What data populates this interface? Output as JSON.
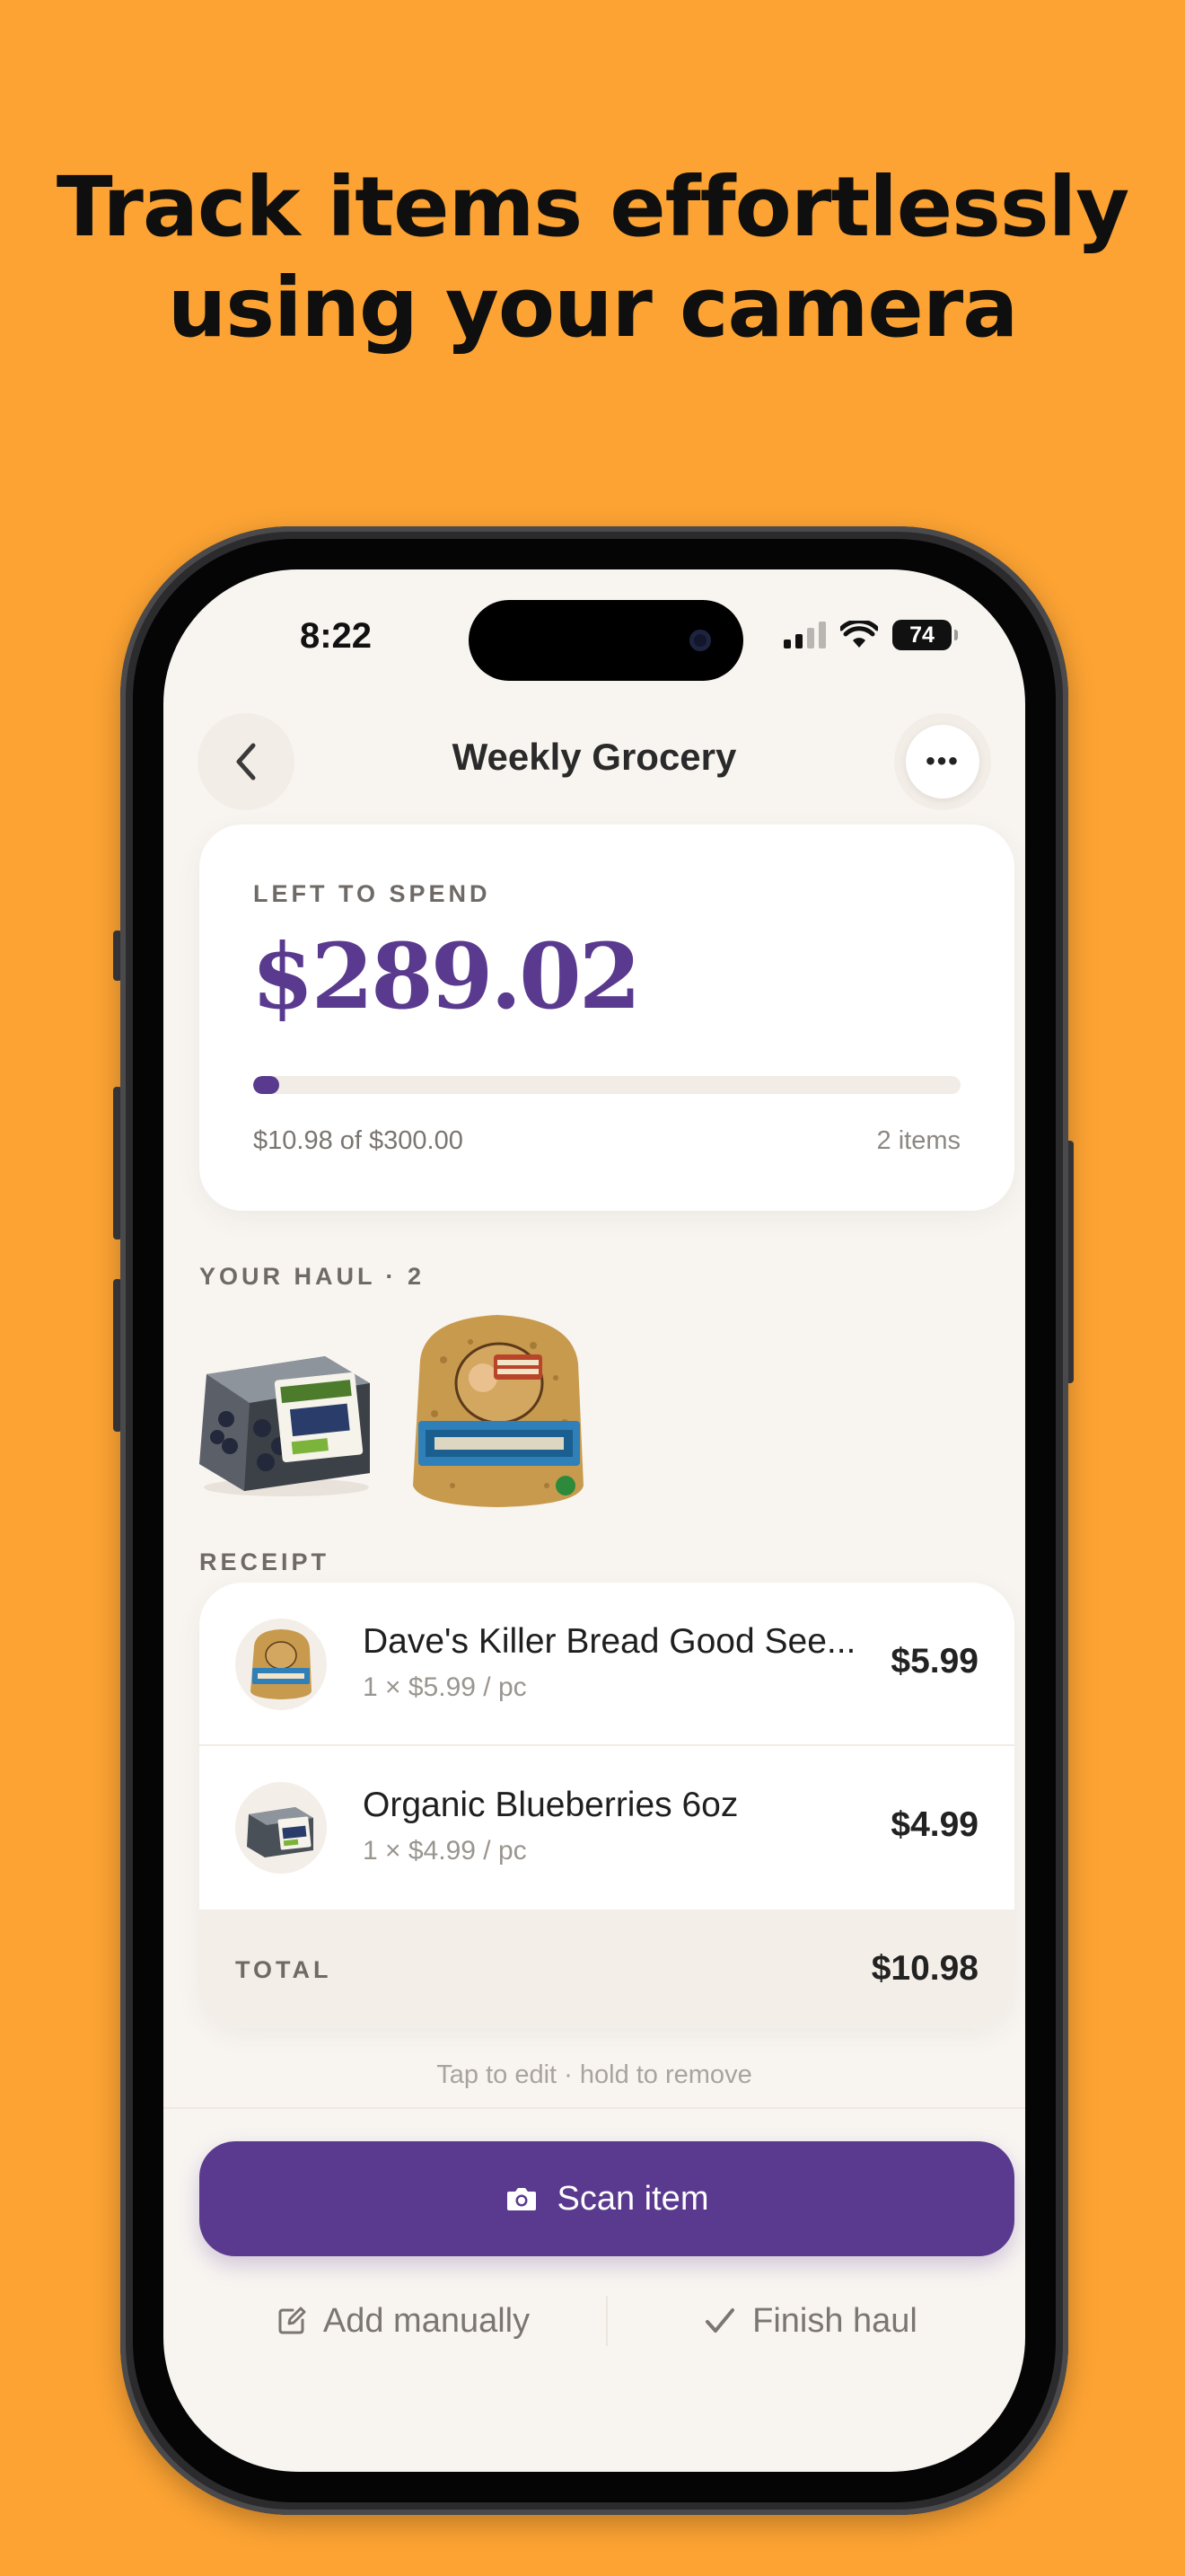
{
  "headline": {
    "line1": "Track items effortlessly",
    "line2": "using your camera"
  },
  "colors": {
    "background": "#FCA333",
    "accent": "#5A3A8E",
    "screen": "#F8F5F1"
  },
  "status_bar": {
    "time": "8:22",
    "battery": "74",
    "icons": [
      "cellular-signal-icon",
      "wifi-icon",
      "battery-icon"
    ]
  },
  "nav": {
    "title": "Weekly Grocery",
    "back_icon": "chevron-left-icon",
    "more_icon": "ellipsis-icon",
    "more_label": "•••"
  },
  "budget": {
    "label": "LEFT TO SPEND",
    "amount": "$289.02",
    "spent_text": "$10.98 of $300.00",
    "items_text": "2 items",
    "progress_fraction": 0.0366
  },
  "haul": {
    "label": "YOUR HAUL · 2",
    "items": [
      "Organic Blueberries",
      "Dave's Killer Bread Good Seed"
    ]
  },
  "receipt": {
    "label": "RECEIPT",
    "rows": [
      {
        "name": "Dave's Killer Bread Good See...",
        "detail": "1 × $5.99 / pc",
        "price": "$5.99"
      },
      {
        "name": "Organic Blueberries 6oz",
        "detail": "1 × $4.99 / pc",
        "price": "$4.99"
      }
    ],
    "total_label": "TOTAL",
    "total_value": "$10.98"
  },
  "hint": "Tap to edit · hold to remove",
  "actions": {
    "scan_label": "Scan item",
    "scan_icon": "camera-icon",
    "manual_label": "Add manually",
    "manual_icon": "edit-icon",
    "finish_label": "Finish haul",
    "finish_icon": "checkmark-icon"
  }
}
